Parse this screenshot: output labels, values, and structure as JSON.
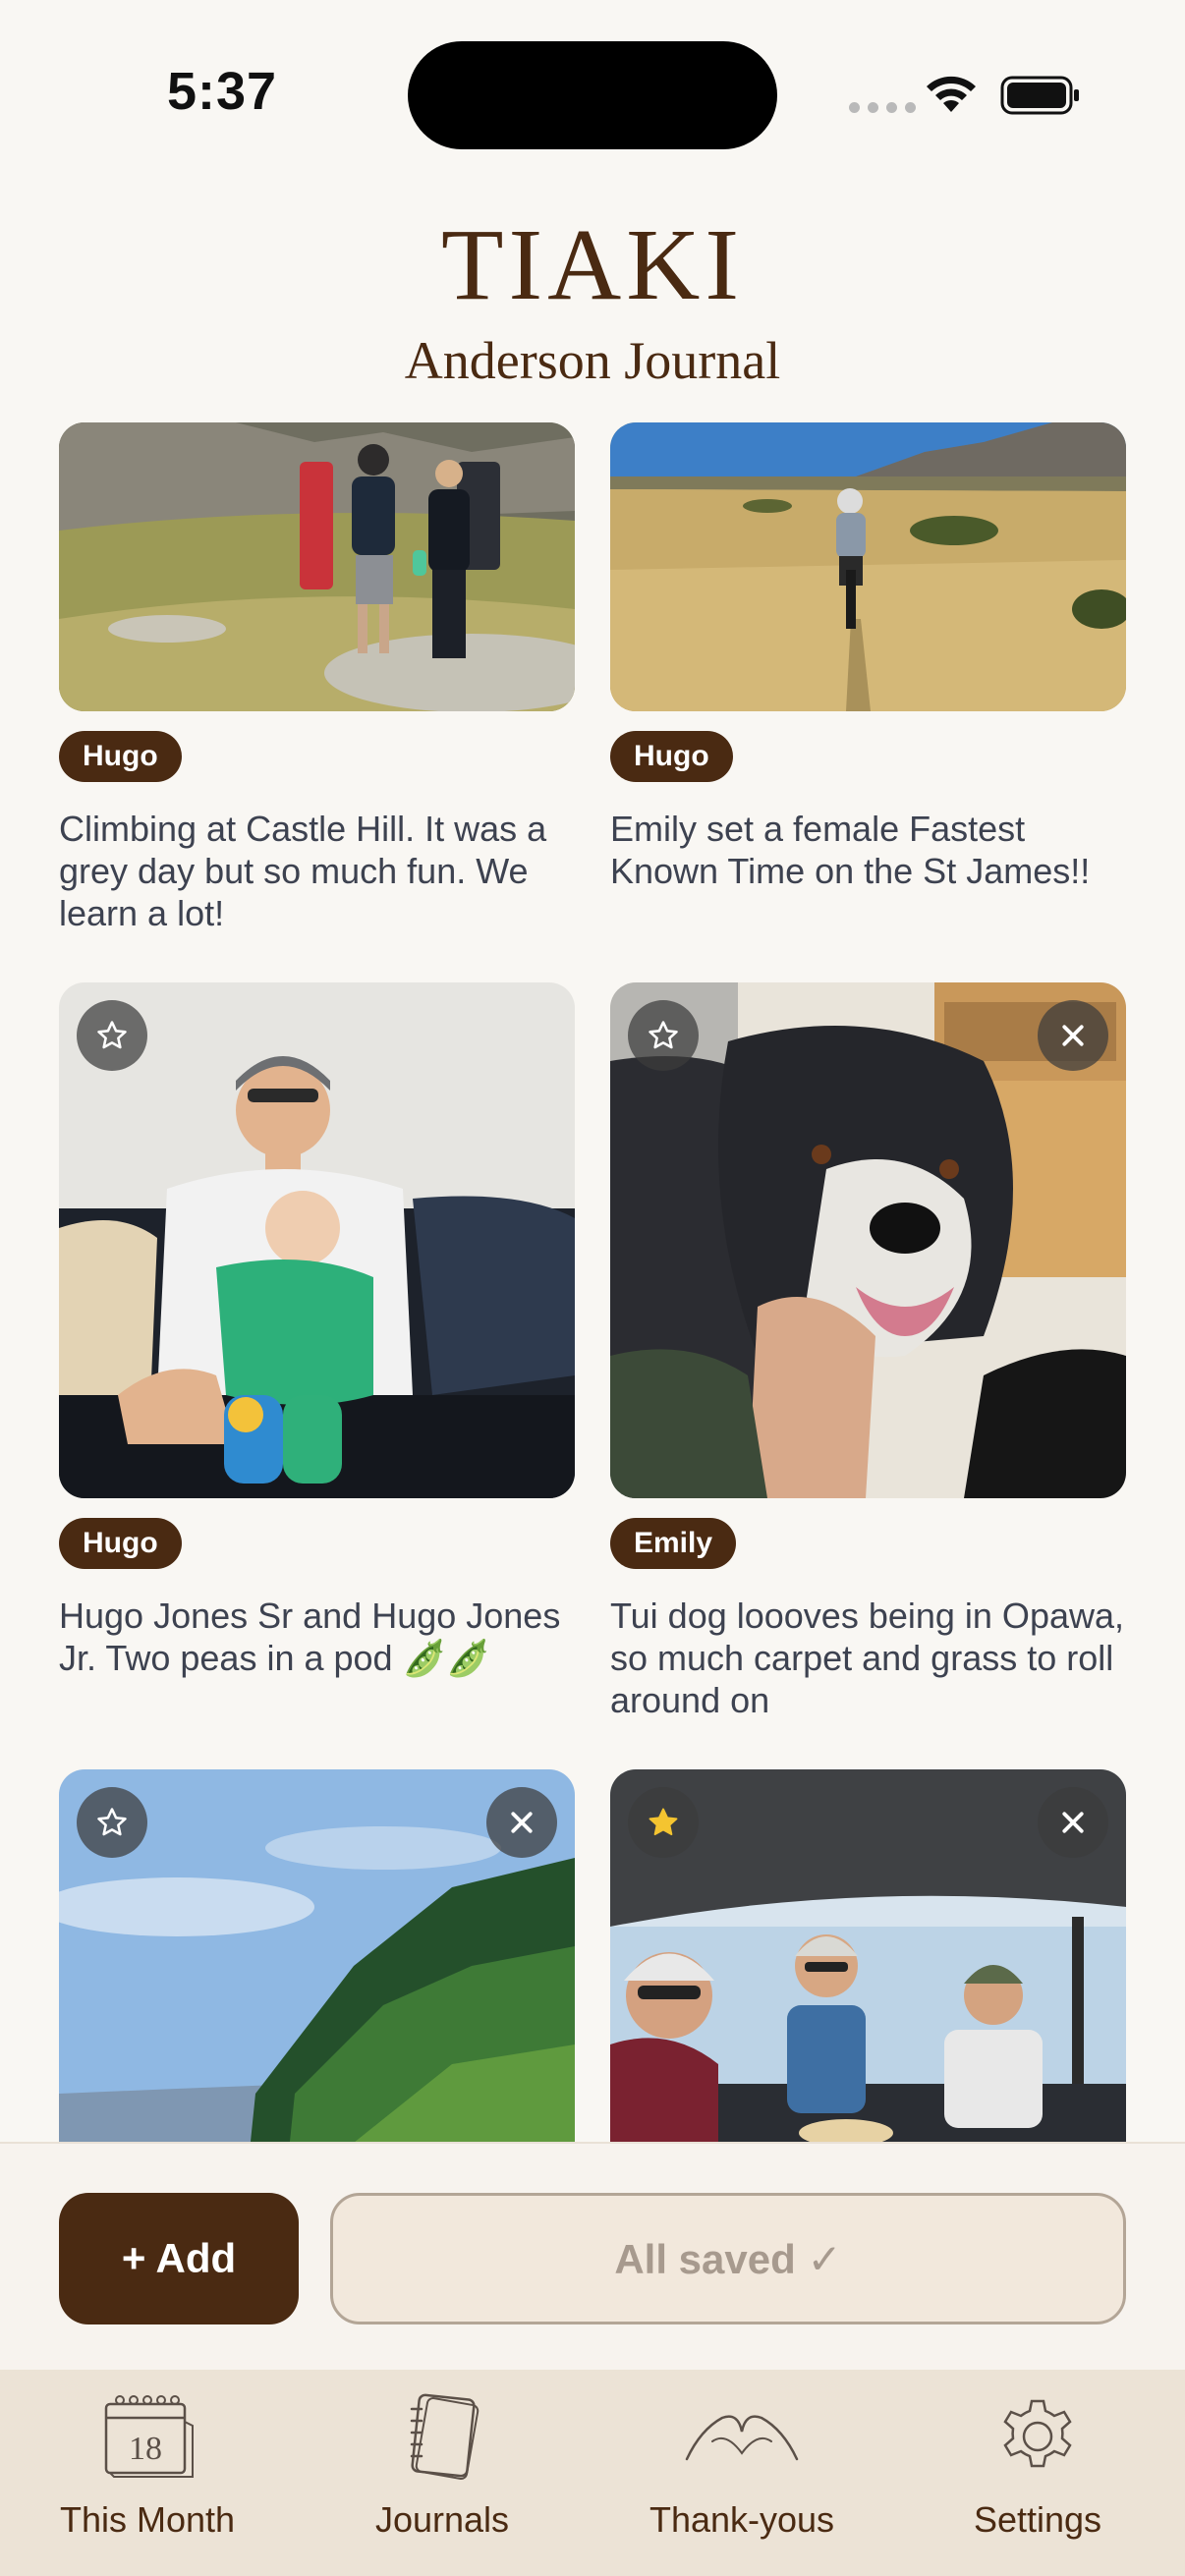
{
  "status_bar": {
    "time": "5:37",
    "icons": [
      "cellular-signal-icon",
      "wifi-icon",
      "battery-icon"
    ]
  },
  "header": {
    "brand": "TIAKI",
    "journal_title": "Anderson Journal"
  },
  "colors": {
    "brand_brown": "#4a2a12",
    "background": "#f9f7f3",
    "tab_bar_bg": "#ece3d6",
    "star_active": "#f4c430"
  },
  "entries": [
    {
      "author": "Hugo",
      "caption": "Climbing at Castle Hill. It was a grey day but so much fun. We learn a lot!",
      "starred": false,
      "photo": "two-climbers-with-crash-pads"
    },
    {
      "author": "Hugo",
      "caption": "Emily set a female Fastest Known Time on the St James!!",
      "starred": false,
      "photo": "cyclist-in-golden-grass"
    },
    {
      "author": "Hugo",
      "caption": "Hugo Jones Sr and Hugo Jones Jr. Two peas in a pod 🫛🫛",
      "starred": false,
      "photo": "man-holding-baby-on-couch"
    },
    {
      "author": "Emily",
      "caption": "Tui dog loooves being in Opawa, so much carpet and grass to roll around on",
      "starred": false,
      "photo": "black-and-white-dog"
    },
    {
      "author": "",
      "caption": "",
      "starred": false,
      "photo": "forested-hillside-sky"
    },
    {
      "author": "",
      "caption": "",
      "starred": true,
      "photo": "friends-on-boat"
    }
  ],
  "actions": {
    "add_label": "+ Add",
    "save_status": "All saved ✓"
  },
  "tabs": [
    {
      "label": "This Month",
      "icon": "calendar-icon",
      "calendar_day": "18"
    },
    {
      "label": "Journals",
      "icon": "notebook-icon"
    },
    {
      "label": "Thank-yous",
      "icon": "heart-hands-icon"
    },
    {
      "label": "Settings",
      "icon": "gear-icon"
    }
  ]
}
